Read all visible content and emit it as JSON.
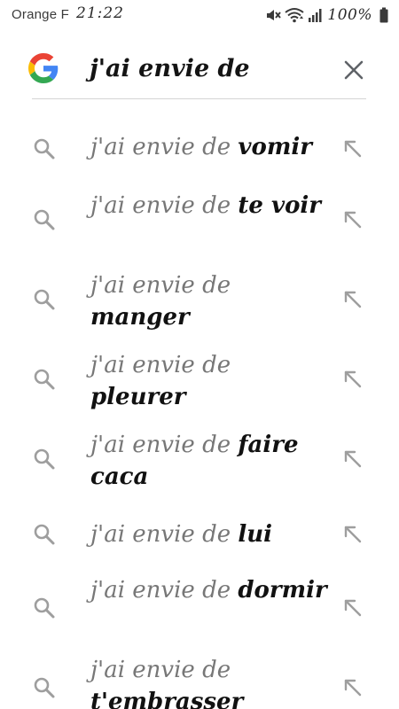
{
  "status_bar": {
    "carrier": "Orange F",
    "time": "21:22",
    "battery": "100%",
    "icons": [
      "mute-icon",
      "wifi-icon",
      "signal-icon",
      "battery-icon"
    ]
  },
  "search": {
    "logo": "google-logo-icon",
    "query": "j'ai envie de",
    "clear_icon": "close-icon"
  },
  "suggestions": [
    {
      "prefix": "j'ai envie de",
      "completion": "vomir"
    },
    {
      "prefix": "j'ai envie de",
      "completion": "te voir"
    },
    {
      "prefix": "j'ai envie de",
      "completion": "manger"
    },
    {
      "prefix": "j'ai envie de",
      "completion": "pleurer"
    },
    {
      "prefix": "j'ai envie de",
      "completion": "faire caca"
    },
    {
      "prefix": "j'ai envie de",
      "completion": "lui"
    },
    {
      "prefix": "j'ai envie de",
      "completion": "dormir"
    },
    {
      "prefix": "j'ai envie de",
      "completion": "t'embrasser"
    }
  ],
  "colors": {
    "icon_gray": "#9e9e9e",
    "prefix_gray": "#777777",
    "completion_black": "#111111",
    "google_blue": "#4285F4",
    "google_red": "#EA4335",
    "google_yellow": "#FBBC05",
    "google_green": "#34A853"
  }
}
